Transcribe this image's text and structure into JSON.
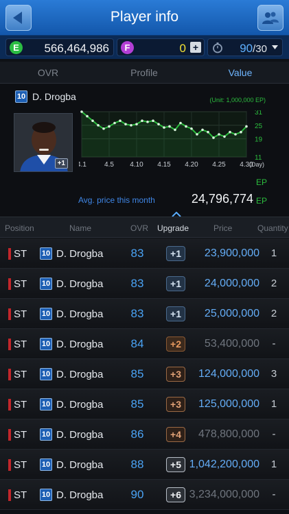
{
  "header": {
    "title": "Player info"
  },
  "currency": {
    "e_badge": "E",
    "e_value": "566,464,986",
    "f_badge": "F",
    "f_value": "0",
    "f_add": "+",
    "stamina_current": "90",
    "stamina_max": "/30",
    "e_color": "#2bbd43",
    "f_color": "#b33fd6"
  },
  "tabs": [
    {
      "label": "OVR",
      "active": false
    },
    {
      "label": "Profile",
      "active": false
    },
    {
      "label": "Value",
      "active": true
    }
  ],
  "player": {
    "season": "10",
    "name": "D. Drogba",
    "photo_level": "+1"
  },
  "chart_data": {
    "type": "line",
    "unit_note": "(Unit: 1,000,000 EP)",
    "x_ticks": [
      "4.1",
      "4.5",
      "4.10",
      "4.15",
      "4.20",
      "4.25",
      "4.30"
    ],
    "x_unit": "(Day)",
    "y_ticks": [
      "31",
      "25",
      "19",
      "11"
    ],
    "ylim": [
      11,
      31
    ],
    "series": [
      {
        "values": [
          31,
          29,
          27,
          25,
          23.5,
          24.5,
          26,
          27,
          25.5,
          25,
          25.5,
          27,
          26.5,
          27,
          25.5,
          24,
          24.5,
          23,
          26,
          24.5,
          23.5,
          21,
          23,
          22,
          19.5,
          21,
          20,
          22,
          21,
          22,
          24.5
        ]
      }
    ],
    "grid": true,
    "line_color": "#2cbd3e"
  },
  "avg": {
    "label": "Avg. price this month",
    "value": "24,796,774",
    "ep_upper": "EP",
    "ep_lower": "EP"
  },
  "table": {
    "headers": {
      "position": "Position",
      "name": "Name",
      "ovr": "OVR",
      "upgrade": "Upgrade",
      "price": "Price",
      "quantity": "Quantity"
    },
    "rows": [
      {
        "pos": "ST",
        "season": "10",
        "name": "D. Drogba",
        "ovr": "83",
        "upgrade": "+1",
        "tier": "t1",
        "price": "23,900,000",
        "avail": true,
        "qty": "1"
      },
      {
        "pos": "ST",
        "season": "10",
        "name": "D. Drogba",
        "ovr": "83",
        "upgrade": "+1",
        "tier": "t1",
        "price": "24,000,000",
        "avail": true,
        "qty": "2"
      },
      {
        "pos": "ST",
        "season": "10",
        "name": "D. Drogba",
        "ovr": "83",
        "upgrade": "+1",
        "tier": "t1",
        "price": "25,000,000",
        "avail": true,
        "qty": "2"
      },
      {
        "pos": "ST",
        "season": "10",
        "name": "D. Drogba",
        "ovr": "84",
        "upgrade": "+2",
        "tier": "t2",
        "price": "53,400,000",
        "avail": false,
        "qty": "-"
      },
      {
        "pos": "ST",
        "season": "10",
        "name": "D. Drogba",
        "ovr": "85",
        "upgrade": "+3",
        "tier": "t3",
        "price": "124,000,000",
        "avail": true,
        "qty": "3"
      },
      {
        "pos": "ST",
        "season": "10",
        "name": "D. Drogba",
        "ovr": "85",
        "upgrade": "+3",
        "tier": "t3",
        "price": "125,000,000",
        "avail": true,
        "qty": "1"
      },
      {
        "pos": "ST",
        "season": "10",
        "name": "D. Drogba",
        "ovr": "86",
        "upgrade": "+4",
        "tier": "t3",
        "price": "478,800,000",
        "avail": false,
        "qty": "-"
      },
      {
        "pos": "ST",
        "season": "10",
        "name": "D. Drogba",
        "ovr": "88",
        "upgrade": "+5",
        "tier": "t4",
        "price": "1,042,200,000",
        "avail": true,
        "qty": "1"
      },
      {
        "pos": "ST",
        "season": "10",
        "name": "D. Drogba",
        "ovr": "90",
        "upgrade": "+6",
        "tier": "t4",
        "price": "3,234,000,000",
        "avail": false,
        "qty": "-"
      }
    ]
  }
}
